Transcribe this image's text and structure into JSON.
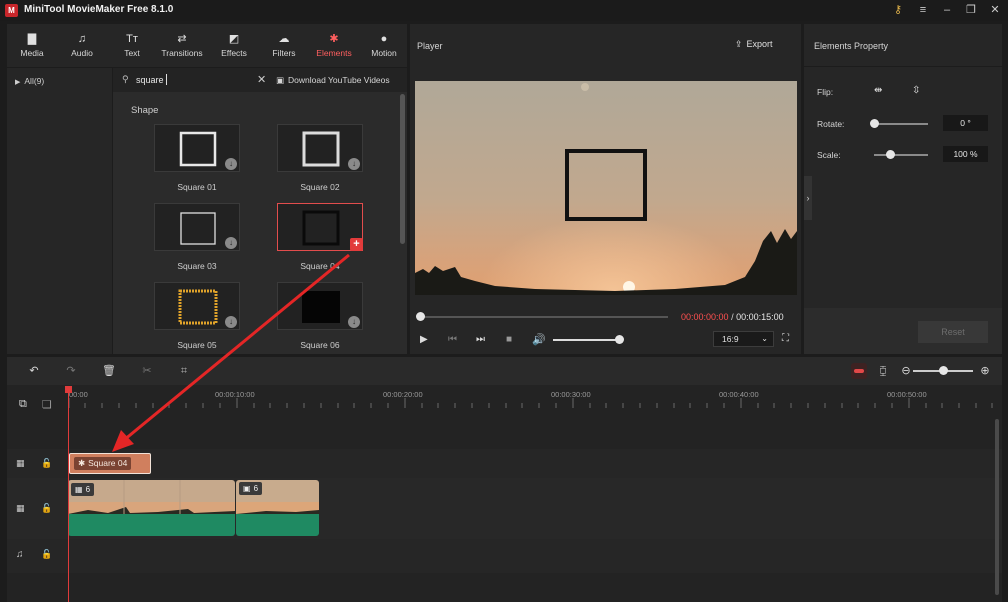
{
  "app": {
    "title": "MiniTool MovieMaker Free 8.1.0"
  },
  "toolbar": {
    "tabs": [
      {
        "label": "Media",
        "icon": "folder-icon"
      },
      {
        "label": "Audio",
        "icon": "music-note-icon"
      },
      {
        "label": "Text",
        "icon": "text-icon"
      },
      {
        "label": "Transitions",
        "icon": "transitions-icon"
      },
      {
        "label": "Effects",
        "icon": "effects-icon"
      },
      {
        "label": "Filters",
        "icon": "filters-icon"
      },
      {
        "label": "Elements",
        "icon": "elements-icon",
        "active": true
      },
      {
        "label": "Motion",
        "icon": "motion-icon"
      }
    ],
    "accent_color": "#ff5f5f"
  },
  "sidebar": {
    "items": [
      {
        "label": "All(9)"
      }
    ]
  },
  "library": {
    "search_value": "square",
    "download_label": "Download YouTube Videos",
    "section_title": "Shape",
    "items": [
      {
        "label": "Square 01"
      },
      {
        "label": "Square 02"
      },
      {
        "label": "Square 03"
      },
      {
        "label": "Square 04",
        "selected": true
      },
      {
        "label": "Square 05"
      },
      {
        "label": "Square 06"
      }
    ]
  },
  "player": {
    "title": "Player",
    "export_label": "Export",
    "current_time": "00:00:00:00",
    "separator": "/",
    "total_time": "00:00:15:00",
    "aspect_ratio": "16:9",
    "progress": 0,
    "volume": 1.0
  },
  "properties": {
    "title": "Elements Property",
    "flip_label": "Flip:",
    "rotate_label": "Rotate:",
    "rotate_value": "0 °",
    "rotate_level": 0,
    "scale_label": "Scale:",
    "scale_value": "100 %",
    "scale_level": 0.3,
    "reset_label": "Reset"
  },
  "timeline": {
    "ruler": [
      "00:00",
      "00:00:10:00",
      "00:00:20:00",
      "00:00:30:00",
      "00:00:40:00",
      "00:00:50:00"
    ],
    "element_clip": {
      "label": "Square 04"
    },
    "video_clips": [
      {
        "count": "6"
      },
      {
        "count": "6"
      }
    ],
    "zoom_level": 0.5
  }
}
